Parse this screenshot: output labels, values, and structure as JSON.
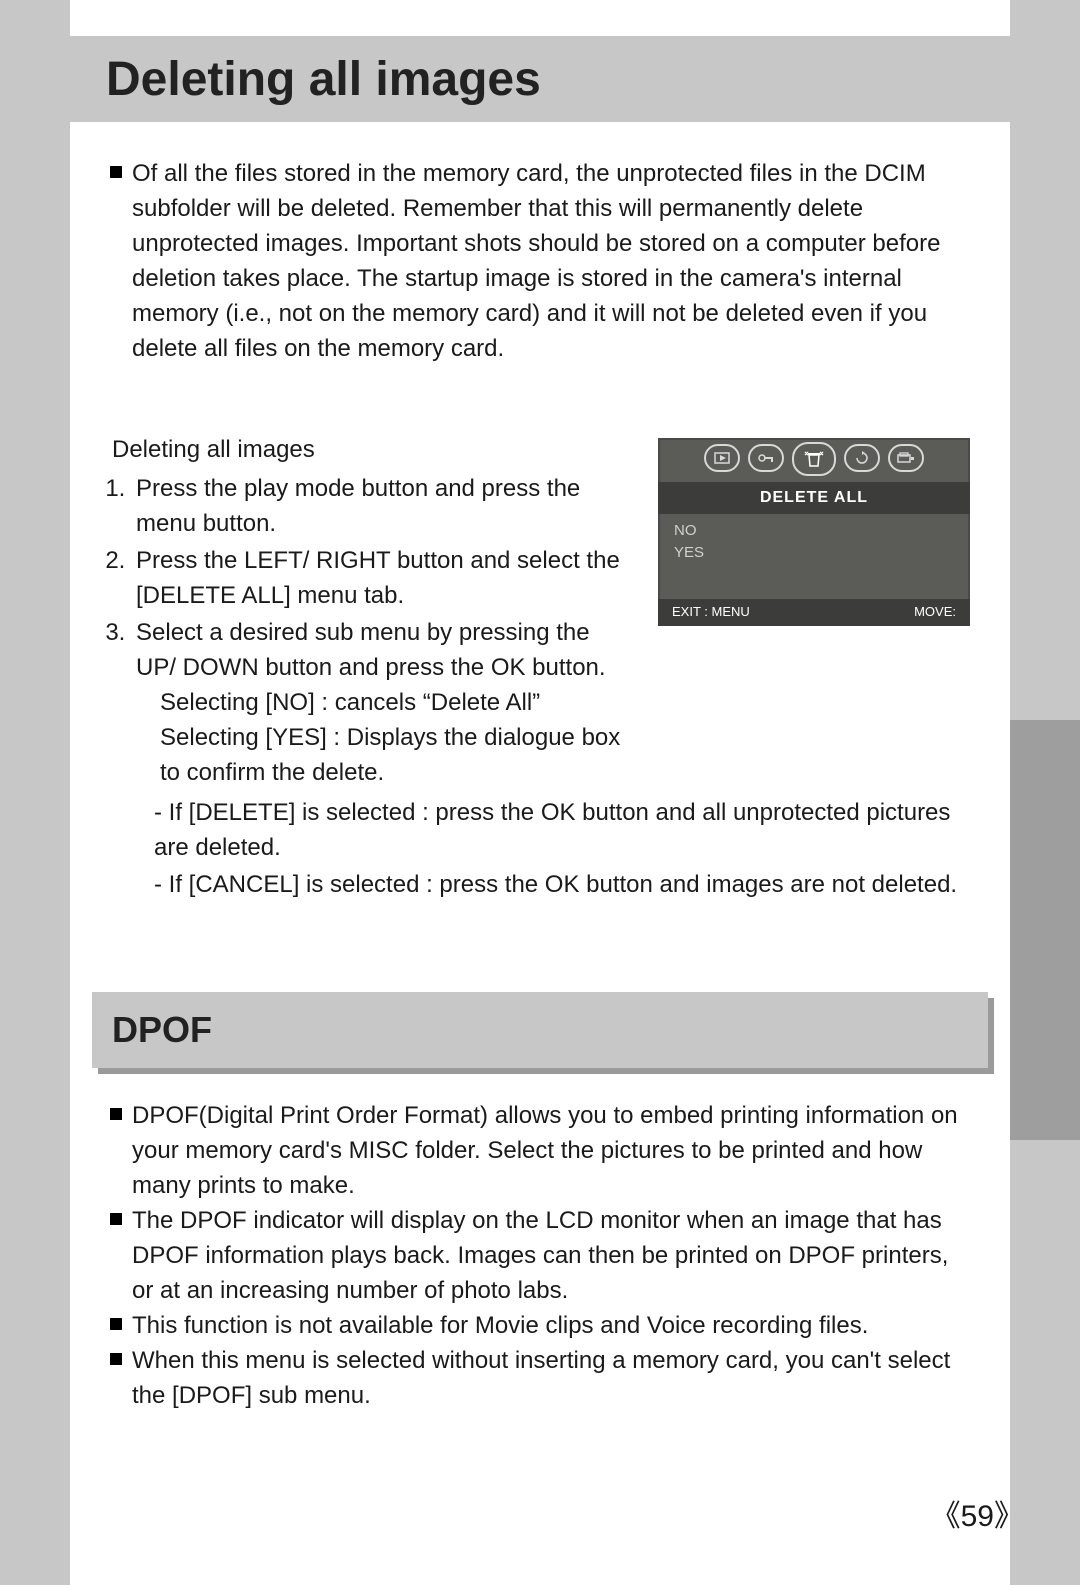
{
  "page": {
    "number": "59"
  },
  "section1": {
    "title": "Deleting all images",
    "intro": "Of all the files stored in the memory card, the unprotected files in the DCIM subfolder will be deleted. Remember that this will permanently delete unprotected images. Important shots should be stored on a computer before deletion takes place. The startup image is stored in the camera's internal memory (i.e., not on the memory card) and it will not be deleted even if you delete all files on the memory card.",
    "steps_title": "Deleting all images",
    "steps": {
      "s1": "Press the play mode button and press the menu button.",
      "s2": "Press the LEFT/ RIGHT button and select the [DELETE ALL] menu tab.",
      "s3": "Select a desired sub menu by pressing the UP/ DOWN button and press the OK button.",
      "sel_no": "Selecting [NO]    : cancels “Delete All”",
      "sel_yes": "Selecting [YES]  : Displays the dialogue box to confirm the delete.",
      "after1": "- If [DELETE] is selected : press the OK button and all unprotected pictures are deleted.",
      "after2": "- If [CANCEL] is selected : press the OK button and images are not deleted."
    }
  },
  "lcd": {
    "header": "DELETE ALL",
    "opt_no": "NO",
    "opt_yes": "YES",
    "footer_left": "EXIT : MENU",
    "footer_right": "MOVE:"
  },
  "section2": {
    "title": "DPOF",
    "b1": "DPOF(Digital Print Order Format) allows you to embed printing information on your memory card's MISC folder. Select the pictures to be printed and how many prints to make.",
    "b2": "The DPOF indicator will display on the LCD monitor when an image that has DPOF information plays back. Images can then be printed on DPOF printers, or at an increasing number of photo labs.",
    "b3": "This function is not available for Movie clips and Voice recording files.",
    "b4": "When this menu is selected without inserting a memory card, you can't select the [DPOF] sub menu."
  }
}
